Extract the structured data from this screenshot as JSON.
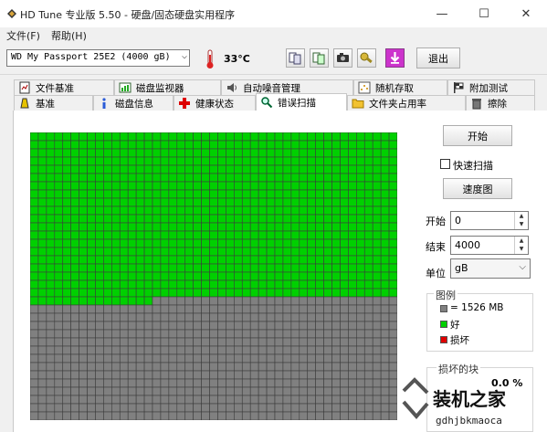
{
  "window": {
    "title": "HD Tune 专业版 5.50 - 硬盘/固态硬盘实用程序",
    "minimize": "—",
    "maximize": "☐",
    "close": "✕"
  },
  "menu": {
    "file": "文件(F)",
    "help": "帮助(H)"
  },
  "toolbar": {
    "drive": "WD     My Passport 25E2 (4000 gB)",
    "temperature": "33°C",
    "exit_label": "退出",
    "buttons": [
      "copy-info-icon",
      "copy-text-icon",
      "screenshot-camera-icon",
      "options-tools-icon",
      "save-download-icon"
    ]
  },
  "tabs_top": [
    "文件基准",
    "磁盘监视器",
    "自动噪音管理",
    "随机存取",
    "附加测试"
  ],
  "tabs_bottom": [
    "基准",
    "磁盘信息",
    "健康状态",
    "错误扫描",
    "文件夹占用率",
    "擦除"
  ],
  "active_tab": "错误扫描",
  "scan": {
    "start_button": "开始",
    "quick_scan_label": "快速扫描",
    "quick_scan_checked": false,
    "speed_map_button": "速度图",
    "start_label": "开始",
    "start_value": "0",
    "end_label": "结束",
    "end_value": "4000",
    "unit_label": "单位",
    "unit_value": "gB",
    "legend_title": "图例",
    "legend_block": "= 1526 MB",
    "legend_good": "好",
    "legend_bad": "损坏",
    "damaged_title": "损坏的块",
    "damaged_percent": "0.0 %"
  },
  "grid_data": {
    "columns": 45,
    "rows": 35,
    "total_blocks": 1575,
    "scanned_good_blocks": 915,
    "colors": {
      "good": "#00d000",
      "unscanned": "#808080",
      "bad": "#e00000",
      "line": "#3c3c3c"
    }
  },
  "colors": {
    "active_tab": "#ffffff",
    "exit_purple": "#cc33cc"
  },
  "watermark": {
    "brand": "装机之家",
    "url": "gdhjbkmaoca"
  }
}
